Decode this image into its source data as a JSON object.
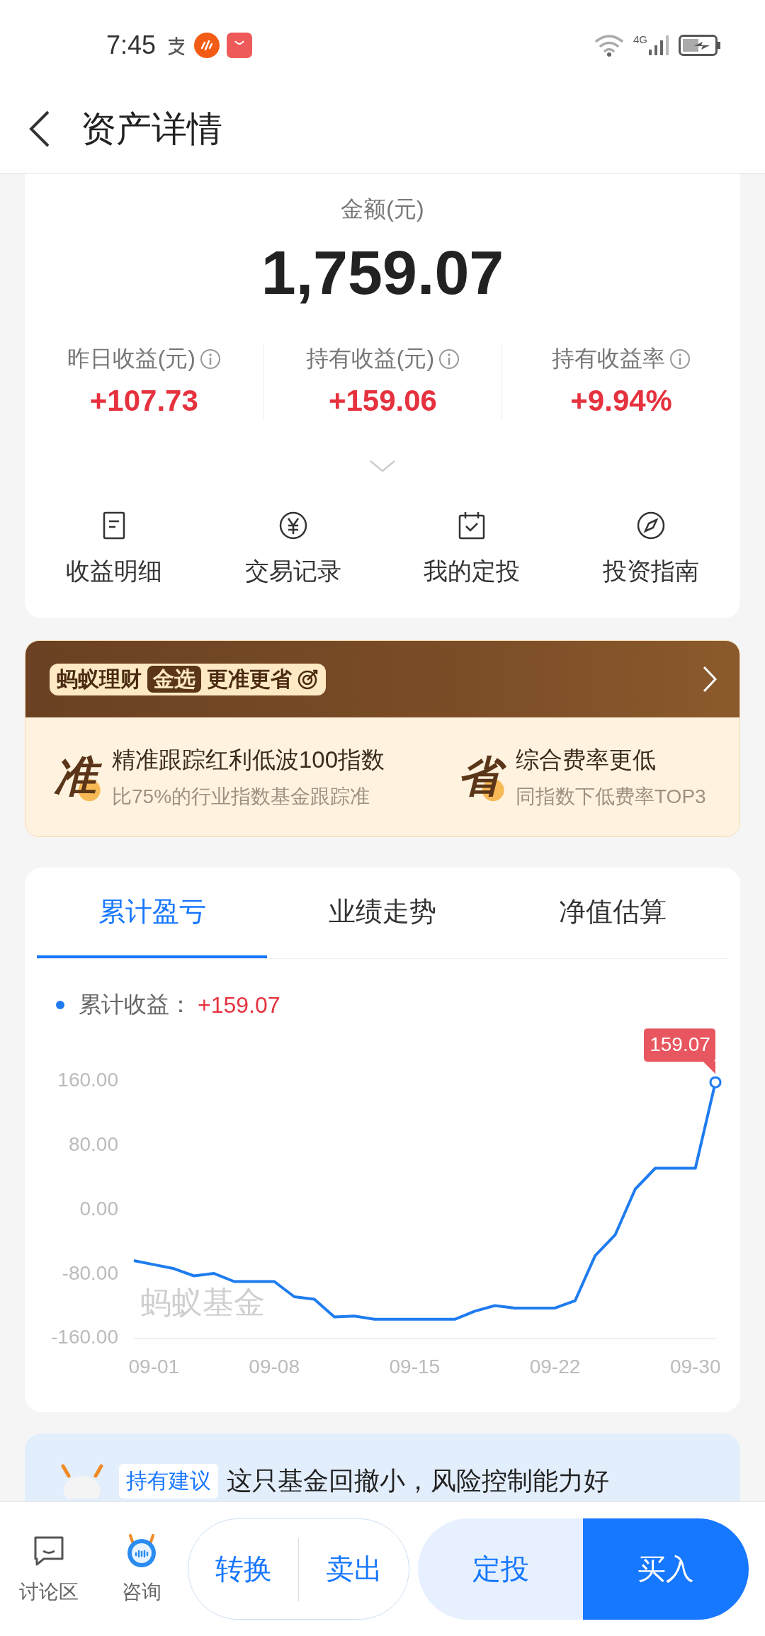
{
  "status_bar": {
    "time": "7:45",
    "network": "4G"
  },
  "header": {
    "title": "资产详情"
  },
  "summary": {
    "amount_label": "金额(元)",
    "amount": "1,759.07",
    "stats": [
      {
        "label": "昨日收益(元)",
        "value": "+107.73"
      },
      {
        "label": "持有收益(元)",
        "value": "+159.06"
      },
      {
        "label": "持有收益率",
        "value": "+9.94%"
      }
    ],
    "actions": [
      {
        "label": "收益明细",
        "kind": "details"
      },
      {
        "label": "交易记录",
        "kind": "records"
      },
      {
        "label": "我的定投",
        "kind": "plan"
      },
      {
        "label": "投资指南",
        "kind": "guide"
      }
    ]
  },
  "banner": {
    "brand": "蚂蚁理财",
    "badge": "金选",
    "slogan": "更准更省",
    "features": [
      {
        "mark": "准",
        "title": "精准跟踪红利低波100指数",
        "subtitle": "比75%的行业指数基金跟踪准"
      },
      {
        "mark": "省",
        "title": "综合费率更低",
        "subtitle": "同指数下低费率TOP3"
      }
    ]
  },
  "chart_card": {
    "tabs": [
      {
        "label": "累计盈亏",
        "selected": true
      },
      {
        "label": "业绩走势",
        "selected": false
      },
      {
        "label": "净值估算",
        "selected": false
      }
    ],
    "legend": {
      "label": "累计收益：",
      "value": "+159.07"
    },
    "watermark": "蚂蚁基金",
    "chart_data": {
      "type": "line",
      "categories": [
        null,
        "09-01",
        null,
        null,
        null,
        null,
        null,
        "09-08",
        null,
        null,
        null,
        null,
        null,
        null,
        "09-15",
        null,
        null,
        null,
        null,
        null,
        null,
        "09-22",
        null,
        null,
        null,
        null,
        null,
        null,
        "09-30",
        null
      ],
      "series": [
        {
          "color": "#1f7cf0",
          "values": [
            -63,
            -68,
            -73,
            -82,
            -79,
            -89,
            -89,
            -89,
            -108,
            -111,
            -133,
            -132,
            -136,
            -136,
            -136,
            -136,
            -136,
            -126,
            -119,
            -122,
            -122,
            -122,
            -113,
            -57,
            -31,
            26,
            52,
            52,
            52,
            159
          ]
        }
      ],
      "ylim": [
        -160,
        160
      ],
      "yticks": [
        {
          "value": 160,
          "label": "160.00"
        },
        {
          "value": 80,
          "label": "80.00"
        },
        {
          "value": 0,
          "label": "0.00"
        },
        {
          "value": -80,
          "label": "-80.00"
        },
        {
          "value": -160,
          "label": "-160.00"
        }
      ],
      "annotations": [
        "159.07"
      ]
    }
  },
  "suggestion": {
    "tag": "持有建议",
    "text": "这只基金回撤小，风险控制能力好"
  },
  "bottom_bar": {
    "links": [
      {
        "label": "讨论区",
        "kind": "discussion"
      },
      {
        "label": "咨询",
        "kind": "assistant"
      }
    ],
    "buttons": [
      {
        "label": "转换",
        "kind": "outline"
      },
      {
        "label": "卖出",
        "kind": "outline"
      },
      {
        "label": "定投",
        "kind": "secondary"
      },
      {
        "label": "买入",
        "kind": "primary"
      }
    ]
  }
}
